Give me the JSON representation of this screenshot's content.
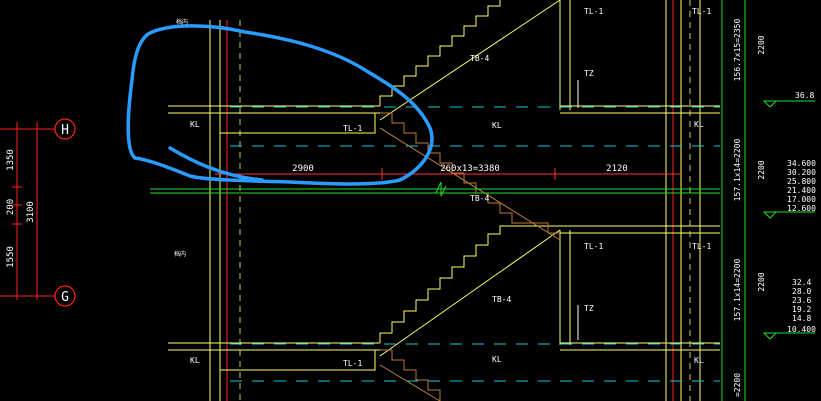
{
  "colors": {
    "background": "#000000",
    "wall": "#ffff66",
    "wall_dim": "#d8d880",
    "axis": "#ff2020",
    "dim": "#ff3030",
    "cyan_dash": "#18c8d8",
    "green": "#22dd22",
    "stair_brown": "#b87a3a",
    "white_text": "#ffffff",
    "markup_blue": "#2a9bff"
  },
  "axes": {
    "H": {
      "label": "H"
    },
    "G": {
      "label": "G"
    }
  },
  "left_dims": {
    "seg1": "1350",
    "seg2": "200",
    "seg3": "1550",
    "total": "3100"
  },
  "beam_labels": {
    "kl_left_top": "KL",
    "kl_left_bottom": "KL",
    "kl_mid_top": "KL",
    "kl_mid_bottom": "KL",
    "kl_right_top": "KL",
    "kl_right_bottom": "KL",
    "tl_top_left": "TL-1",
    "tl_bottom_left": "TL-1",
    "tl_top_right": "TL-1",
    "tl_mid_right": "TL-1",
    "tl_mid_right2": "TL-1",
    "tl_top_right2": "TL-1",
    "tz_top": "TZ",
    "tz_bottom": "TZ",
    "tb_top": "TB-4",
    "tb_mid": "TB-4",
    "tb_bottom": "TB-4"
  },
  "center_dims": {
    "left": "2900",
    "middle": "260x13=3380",
    "right": "2120"
  },
  "right_vert_dims": {
    "top_total": "2200",
    "top_steps": "156.7x15=2350",
    "mid_steps": "157.1x14=2200",
    "mid_total": "2200",
    "bot_steps": "157.1x14=2200",
    "bot_total": "2200",
    "bot_steps2": "=2200"
  },
  "elevations": {
    "top": "36.8",
    "group1": [
      "34.600",
      "30.200",
      "25.800",
      "21.400",
      "17.000",
      "12.600"
    ],
    "group2": [
      "32.4",
      "28.0",
      "23.6",
      "19.2",
      "14.8",
      "10.400"
    ]
  },
  "small_labels": {
    "top_note": "档内",
    "mid_note": "档内"
  }
}
